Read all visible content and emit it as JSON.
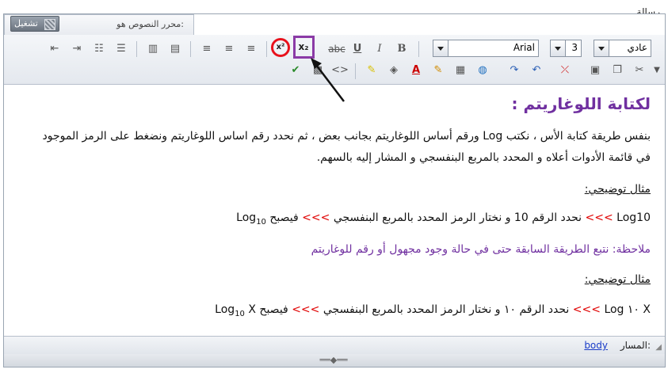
{
  "header": {
    "title": "رسالة"
  },
  "tabs": {
    "editor_label": "محرر النصوص هو:",
    "run_label": "تشغيل"
  },
  "toolbar": {
    "font_style_value": "عادي",
    "font_size_value": "3",
    "font_name_value": "Arial",
    "bold": "B",
    "italic": "I",
    "underline": "U",
    "strike": "abc",
    "subscript": "x₂",
    "superscript": "x²"
  },
  "content": {
    "heading": "لكتابة اللوغاريتم :",
    "para1_line1": "بنفس طريقة كتابة الأس ، نكتب Log ورقم أساس اللوغاريتم بجانب بعض ، ثم نحدد رقم اساس اللوغاريتم ونضغط على الرمز الموجود",
    "para1_line2": "في قائمة الأدوات أعلاه و المحدد بالمربع البنفسجي و المشار إليه بالسهم.",
    "example1_title": "مثال توضيحي:",
    "ex1_start": "Log10",
    "ex1_arrows1": ">>>",
    "ex1_mid": "نحدد الرقم 10 و نختار الرمز المحدد بالمربع البنفسجي",
    "ex1_arrows2": ">>>",
    "ex1_then": "فيصبح",
    "ex1_result_base": "Log",
    "ex1_result_sub": "10",
    "note": "ملاحظة: نتبع الطريقة السابقة حتى في حالة وجود مجهول أو رقم للوغاريتم",
    "example2_title": "مثال توضيحي:",
    "ex2_start": "Log ١٠ X",
    "ex2_arrows1": ">>>",
    "ex2_mid": "نحدد الرقم ١٠ و نختار الرمز المحدد بالمربع البنفسجي",
    "ex2_arrows2": ">>>",
    "ex2_then": "فيصبح",
    "ex2_result_base": "Log",
    "ex2_result_sub": "10",
    "ex2_result_x": "X"
  },
  "status": {
    "path_label": "المسار:",
    "path_link": "body"
  },
  "colors": {
    "highlight_circle": "#e8121c",
    "highlight_square": "#8b3aa6",
    "heading": "#7030a0",
    "arrows": "#e00000"
  }
}
